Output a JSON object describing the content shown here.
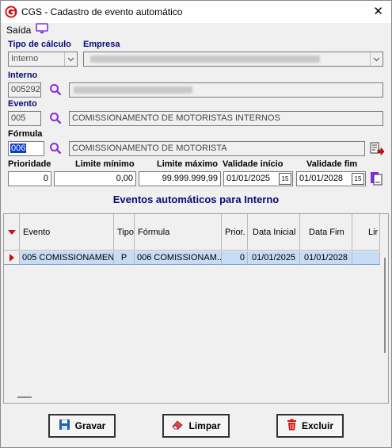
{
  "window": {
    "title": "CGS - Cadastro de evento automático",
    "close_label": "✕"
  },
  "menu": {
    "saida_label": "Saída"
  },
  "form": {
    "tipo_calculo_label": "Tipo de cálculo",
    "tipo_calculo_value": "Interno",
    "empresa_label": "Empresa",
    "interno_label": "Interno",
    "interno_code": "005292",
    "evento_label": "Evento",
    "evento_code": "005",
    "evento_desc": "COMISSIONAMENTO DE MOTORISTAS INTERNOS",
    "formula_label": "Fórmula",
    "formula_code": "006",
    "formula_desc": "COMISSIONAMENTO DE MOTORISTA",
    "prioridade_label": "Prioridade",
    "prioridade_value": "0",
    "limite_minimo_label": "Limite mínimo",
    "limite_minimo_value": "0,00",
    "limite_maximo_label": "Limite máximo",
    "limite_maximo_value": "99.999.999,99",
    "validade_inicio_label": "Validade início",
    "validade_inicio_value": "01/01/2025",
    "validade_fim_label": "Validade fim",
    "validade_fim_value": "01/01/2028",
    "calendar_label": "15"
  },
  "section_title": "Eventos automáticos para Interno",
  "grid": {
    "columns": [
      "Evento",
      "Tipo",
      "Fórmula",
      "Prior.",
      "Data Inicial",
      "Data Fim",
      "Lir"
    ],
    "rows": [
      [
        "005 COMISSIONAMEN...",
        "P",
        "006 COMISSIONAM...",
        "0",
        "01/01/2025",
        "01/01/2028",
        ""
      ]
    ]
  },
  "buttons": {
    "gravar": "Gravar",
    "limpar": "Limpar",
    "excluir": "Excluir"
  },
  "colors": {
    "label_blue": "#0a0a7a",
    "accent_red": "#d01010",
    "selection": "#c6dcf5",
    "icon_purple": "#8a2be2"
  }
}
